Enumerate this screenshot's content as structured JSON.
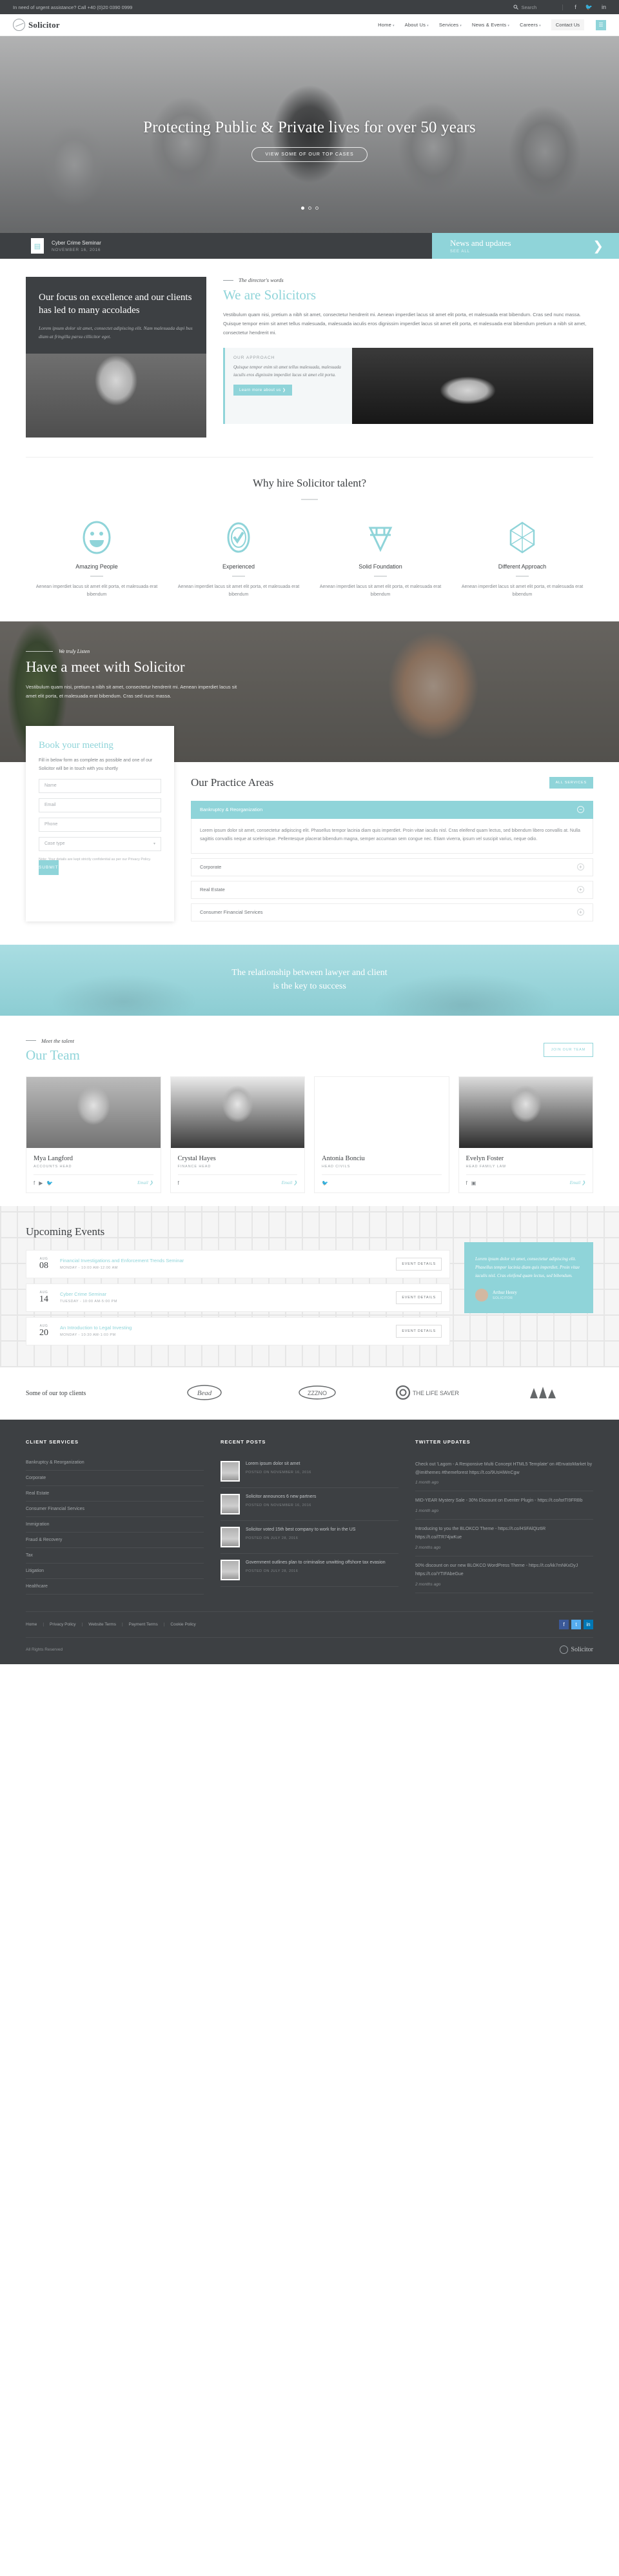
{
  "topbar": {
    "phone": "In need of urgent assistance? Call +40 (0)20 0390 0999",
    "search_placeholder": "Search",
    "social": [
      "facebook-icon",
      "twitter-icon",
      "linkedin-icon"
    ]
  },
  "header": {
    "logo_text": "Solicitor",
    "nav": [
      {
        "label": "Home",
        "caret": "▾"
      },
      {
        "label": "About Us",
        "caret": "▾"
      },
      {
        "label": "Services",
        "caret": "▾"
      },
      {
        "label": "News & Events",
        "caret": "▾"
      },
      {
        "label": "Careers",
        "caret": "▾"
      }
    ],
    "contact_label": "Contact Us",
    "menu_button": "☰"
  },
  "hero": {
    "title": "Protecting Public & Private lives for over 50 years",
    "button": "VIEW SOME OF OUR TOP CASES",
    "news_item_title": "Cyber Crime Seminar",
    "news_item_date": "NOVEMBER 16, 2016",
    "news_heading": "News and updates",
    "news_seeall": "SEE ALL",
    "news_arrow": "❯"
  },
  "director": {
    "card_heading": "Our focus on excellence and our clients has led to many accolades",
    "card_text": "Lorem ipsum dolor sit amet, consectet adipiscing elit. Nam malesuada dapi bus diam at fringilla parsu cillicitor eget.",
    "eyebrow": "The director's words",
    "heading": "We are Solicitors",
    "paragraph": "Vestibulum quam nisi, pretium a nibh sit amet, consectetur hendrerit mi. Aenean imperdiet lacus sit amet elit porta, et malesuada erat bibendum. Cras sed nunc massa. Quisque tempor enim sit amet tellus malesuada, malesuada iaculis eros dignissim imperdiet lacus sit amet elit porta, et malesuada erat bibendum pretium a nibh sit amet, consectetur hendrerit mi.",
    "quote_title": "OUR APPROACH",
    "quote_text": "Quisque tempor enim sit amet tellus malesuada, malesuada iaculis eros dignissim imperdiet lacus sit amet elit porta.",
    "quote_button": "Learn more about us ❯"
  },
  "why": {
    "heading": "Why hire Solicitor talent?",
    "cards": [
      {
        "icon": "smiley-icon",
        "title": "Amazing People",
        "text": "Aenean imperdiet lacus sit amet elit porta, et malesuada erat bibendum"
      },
      {
        "icon": "check-circle-icon",
        "title": "Experienced",
        "text": "Aenean imperdiet lacus sit amet elit porta, et malesuada erat bibendum"
      },
      {
        "icon": "diamond-icon",
        "title": "Solid Foundation",
        "text": "Aenean imperdiet lacus sit amet elit porta, et malesuada erat bibendum"
      },
      {
        "icon": "hexagon-icon",
        "title": "Different Approach",
        "text": "Aenean imperdiet lacus sit amet elit porta, et malesuada erat bibendum"
      }
    ]
  },
  "listen": {
    "eyebrow": "We truly Listen",
    "heading": "Have a meet with Solicitor",
    "paragraph": "Vestibulum quam nisi, pretium a nibh sit amet, consectetur hendrerit mi. Aenean imperdiet lacus sit amet elit porta, et malesuada erat bibendum. Cras sed nunc massa."
  },
  "book": {
    "heading": "Book your meeting",
    "intro": "Fill in below form as complete as possible and one of our Solicitor will be in touch with you shortly",
    "fields": [
      {
        "name": "name-field",
        "placeholder": "Name"
      },
      {
        "name": "email-field",
        "placeholder": "Email"
      },
      {
        "name": "phone-field",
        "placeholder": "Phone"
      }
    ],
    "select_label": "Case type",
    "select_caret": "▾",
    "note": "Note: Your details are kept strictly confidential as per our Privacy Policy.",
    "submit": "SUBMIT"
  },
  "practice": {
    "heading": "Our Practice Areas",
    "all_button": "ALL SERVICES",
    "open_item": "Bankruptcy & Reorganization",
    "open_body": "Lorem ipsum dolor sit amet, consectetur adipiscing elit. Phasellus tempor lacinia diam quis imperdiet. Proin vitae iaculis nisl. Cras eleifend quam lectus, sed bibendum libero convallis at. Nulla sagittis convallis neque at scelerisque. Pellentesque placerat bibendum magna, semper accumsan sem congue nec. Etiam viverra, ipsum vel suscipit varius, neque odio.",
    "items": [
      "Corporate",
      "Real Estate",
      "Consumer Financial Services"
    ],
    "plus": "+",
    "minus": "−"
  },
  "quoteband": {
    "line1": "The relationship between lawyer and client",
    "line2": "is the key to success"
  },
  "team": {
    "eyebrow": "Meet the talent",
    "heading": "Our Team",
    "button": "JOIN OUR TEAM",
    "members": [
      {
        "name": "Mya Langford",
        "role": "ACCOUNTS HEAD",
        "social": [
          "facebook-icon",
          "youtube-icon",
          "twitter-icon"
        ],
        "email": "Email ❯"
      },
      {
        "name": "Crystal Hayes",
        "role": "FINANCE HEAD",
        "social": [
          "facebook-icon"
        ],
        "email": "Email ❯"
      },
      {
        "name": "Antonia Bonciu",
        "role": "HEAD CIVILS",
        "social": [
          "twitter-icon"
        ],
        "email": ""
      },
      {
        "name": "Evelyn Foster",
        "role": "HEAD FAMILY LAW",
        "social": [
          "facebook-icon",
          "instagram-icon"
        ],
        "email": "Email ❯"
      }
    ]
  },
  "events": {
    "heading": "Upcoming Events",
    "items": [
      {
        "month": "AUG",
        "day": "08",
        "title": "Financial Investigations and Enforcement Trends Seminar",
        "when": "MONDAY - 10:00 AM-12:00 AM",
        "button": "EVENT DETAILS"
      },
      {
        "month": "AUG",
        "day": "14",
        "title": "Cyber Crime Seminar",
        "when": "TUESDAY - 10:00 AM-5:00 PM",
        "button": "EVENT DETAILS"
      },
      {
        "month": "AUG",
        "day": "20",
        "title": "An Introduction to Legal Investing",
        "when": "MONDAY - 10:30 AM-1:00 PM",
        "button": "EVENT DETAILS"
      }
    ],
    "testimonial": "Lorem ipsum dolor sit amet, consectetur adipiscing elit. Phasellus tempor lacinia diam quis imperdiet. Proin vitae iaculis nisl. Cras eleifend quam lectus, sed bibendum.",
    "testimonial_author": "Arthur Henry",
    "testimonial_role": "SOLICITOR"
  },
  "clients": {
    "label": "Some of our top clients",
    "logos": [
      "Bead",
      "ZZZNO",
      "THE LIFE SAVER",
      "pine-logo"
    ]
  },
  "footer": {
    "col1_title": "CLIENT SERVICES",
    "col1_links": [
      "Bankruptcy & Reorganization",
      "Corporate",
      "Real Estate",
      "Consumer Financial Services",
      "Immigration",
      "Fraud & Recovery",
      "Tax",
      "Litigation",
      "Healthcare"
    ],
    "col2_title": "RECENT POSTS",
    "col2_posts": [
      {
        "title": "Lorem ipsum dolor sit amet",
        "date": "POSTED ON NOVEMBER 16, 2016"
      },
      {
        "title": "Solicitor announces 6 new partners",
        "date": "POSTED ON NOVEMBER 16, 2016"
      },
      {
        "title": "Solicitor voted 15th best company to work for in the US",
        "date": "POSTED ON JULY 28, 2016"
      },
      {
        "title": "Government outlines plan to criminalise unwitting offshore tax evasion",
        "date": "POSTED ON JULY 28, 2016"
      }
    ],
    "col3_title": "TWITTER UPDATES",
    "col3_tweets": [
      {
        "text": "Check out 'Lagom - A Responsive Multi Concept HTML5 Template' on #EnvatoMarket by @imithemes #themeforest https://t.co/9UsHiWnCgw",
        "ago": "1 month ago"
      },
      {
        "text": "MID-YEAR Mystery Sale - 30% Discount on Eventer Plugin - https://t.co/totTI9FRBb",
        "ago": "1 month ago"
      },
      {
        "text": "Introducing to you the BLOKCO Theme - https://t.co/HSFAlQIz6R https://t.co/lTR74jwKue",
        "ago": "2 months ago"
      },
      {
        "text": "50% discount on our new BLOKCO WordPress Theme - https://t.co/kk7mNKxDyJ https://t.co/YTIFAbeGue",
        "ago": "2 months ago"
      }
    ],
    "bottom_links": [
      "Home",
      "Privacy Policy",
      "Website Terms",
      "Payment Terms",
      "Cookie Policy"
    ],
    "social": [
      "facebook-icon",
      "twitter-icon",
      "linkedin-icon"
    ],
    "copyright": "All Rights Reserved",
    "logo_text": "Solicitor"
  }
}
